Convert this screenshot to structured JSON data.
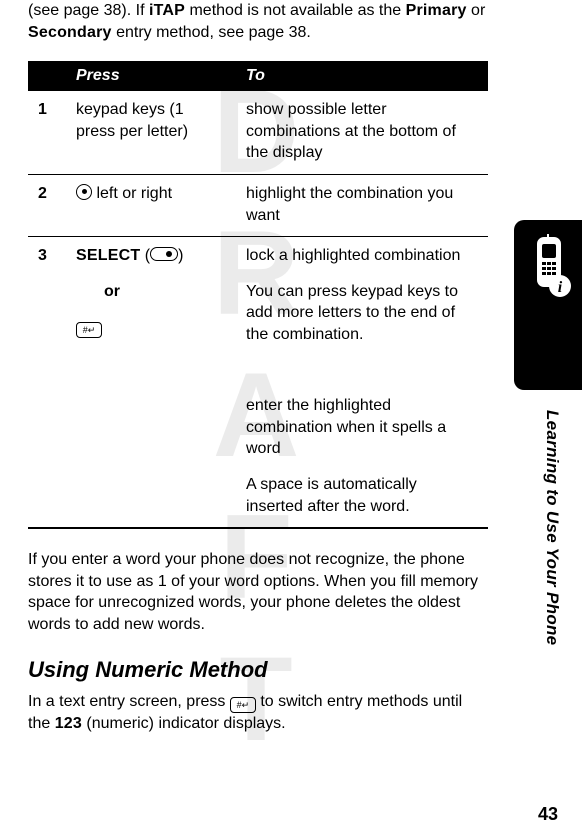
{
  "watermark": "DRAFT",
  "intro": {
    "part1": "(see page 38). If ",
    "itap": "iTAP",
    "part2": " method is not available as the ",
    "primary": "Primary",
    "part3": " or ",
    "secondary": "Secondary",
    "part4": " entry method, see page 38."
  },
  "table": {
    "head_press": "Press",
    "head_to": "To",
    "rows": {
      "r1": {
        "num": "1",
        "press": "keypad keys (1 press per letter)",
        "to": "show possible letter combinations at the bottom of the display"
      },
      "r2": {
        "num": "2",
        "press_suffix": " left or right",
        "to": "highlight the combination you want"
      },
      "r3": {
        "num": "3",
        "select_label": "SELECT",
        "press_paren_open": " (",
        "press_paren_close": ")",
        "to_a": "lock a highlighted combination",
        "to_b": "You can press keypad keys to add more letters to the end of the combination.",
        "or": "or",
        "to_c": "enter the highlighted combination when it spells a word",
        "to_d": "A space is automatically inserted after the word."
      }
    }
  },
  "after_para": "If you enter a word your phone does not recognize, the phone stores it to use as 1 of your word options. When you fill memory space for unrecognized words, your phone deletes the oldest words to add new words.",
  "section_heading": "Using Numeric Method",
  "numeric_para": {
    "part1": "In a text entry screen, press ",
    "part2": " to switch entry methods until the ",
    "indicator": "123",
    "part3": " (numeric) indicator displays."
  },
  "side_label": "Learning to Use Your Phone",
  "page_number": "43"
}
